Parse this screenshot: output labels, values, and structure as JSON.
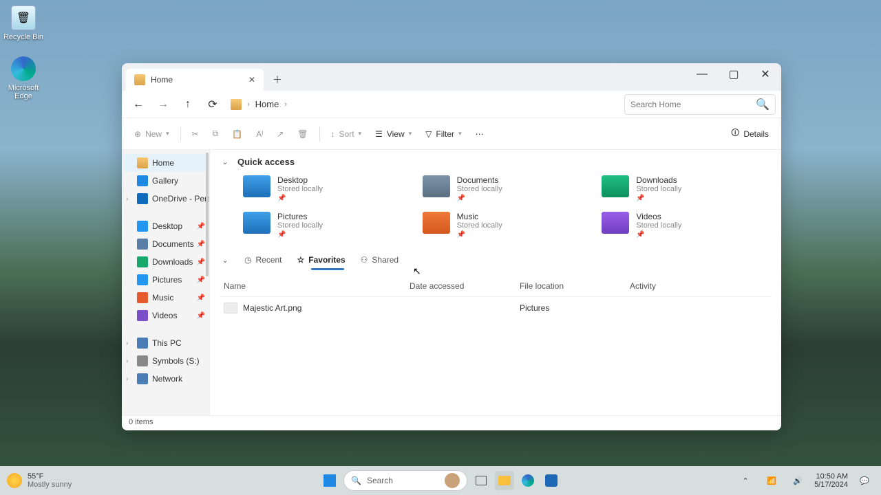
{
  "desktop": {
    "icons": [
      {
        "label": "Recycle Bin"
      },
      {
        "label": "Microsoft Edge"
      }
    ]
  },
  "window": {
    "tab": {
      "title": "Home"
    },
    "breadcrumb": {
      "current": "Home"
    },
    "search": {
      "placeholder": "Search Home"
    },
    "toolbar": {
      "new": "New",
      "sort": "Sort",
      "view": "View",
      "filter": "Filter",
      "details": "Details"
    },
    "sidebar": {
      "home": "Home",
      "gallery": "Gallery",
      "onedrive": "OneDrive - Persc",
      "desktop": "Desktop",
      "documents": "Documents",
      "downloads": "Downloads",
      "pictures": "Pictures",
      "music": "Music",
      "videos": "Videos",
      "thispc": "This PC",
      "drive": "Symbols (S:)",
      "network": "Network"
    },
    "quickaccess": {
      "title": "Quick access",
      "items": [
        {
          "name": "Desktop",
          "sub": "Stored locally"
        },
        {
          "name": "Documents",
          "sub": "Stored locally"
        },
        {
          "name": "Downloads",
          "sub": "Stored locally"
        },
        {
          "name": "Pictures",
          "sub": "Stored locally"
        },
        {
          "name": "Music",
          "sub": "Stored locally"
        },
        {
          "name": "Videos",
          "sub": "Stored locally"
        }
      ]
    },
    "subtabs": {
      "recent": "Recent",
      "favorites": "Favorites",
      "shared": "Shared"
    },
    "columns": {
      "name": "Name",
      "date": "Date accessed",
      "loc": "File location",
      "act": "Activity"
    },
    "rows": [
      {
        "name": "Majestic Art.png",
        "date": "",
        "loc": "Pictures",
        "act": ""
      }
    ],
    "status": "0 items"
  },
  "taskbar": {
    "weather": {
      "temp": "55°F",
      "cond": "Mostly sunny"
    },
    "search": "Search",
    "clock": {
      "time": "10:50 AM",
      "date": "5/17/2024"
    }
  }
}
